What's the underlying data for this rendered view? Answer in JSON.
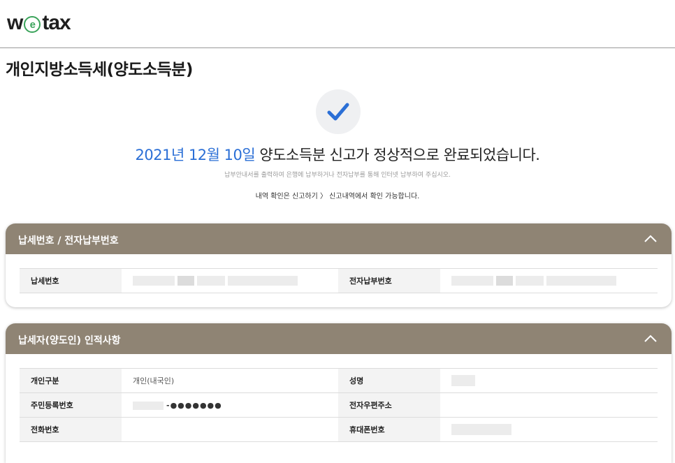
{
  "brand": {
    "logo_w": "w",
    "logo_e": "e",
    "logo_tax": "tax"
  },
  "page_title": "개인지방소득세(양도소득분)",
  "completion": {
    "date": "2021년 12월 10일",
    "message": " 양도소득분 신고가 정상적으로 완료되었습니다.",
    "sub_notice": "납부안내서를 출력하여 은행에 납부하거나 전자납부를 통해 인터넷 납부하여 주십시오.",
    "history_notice": "내역 확인은 신고하기 〉 신고내역에서 확인 가능합니다."
  },
  "panels": {
    "payment": {
      "title": "납세번호 / 전자납부번호",
      "row": {
        "label1": "납세번호",
        "label2": "전자납부번호"
      }
    },
    "taxpayer": {
      "title": "납세자(양도인) 인적사항",
      "rows": [
        {
          "label1": "개인구분",
          "value1": "개인(내국인)",
          "label2": "성명"
        },
        {
          "label1": "주민등록번호",
          "value1_suffix": "-●●●●●●●",
          "label2": "전자우편주소"
        },
        {
          "label1": "전화번호",
          "label2": "휴대폰번호"
        }
      ]
    }
  },
  "colors": {
    "panel_header": "#8f8474",
    "accent_date": "#2b6fd6",
    "check": "#2b6fd6"
  },
  "icons": {
    "check": "check-icon",
    "collapse": "chevron-up-icon"
  }
}
